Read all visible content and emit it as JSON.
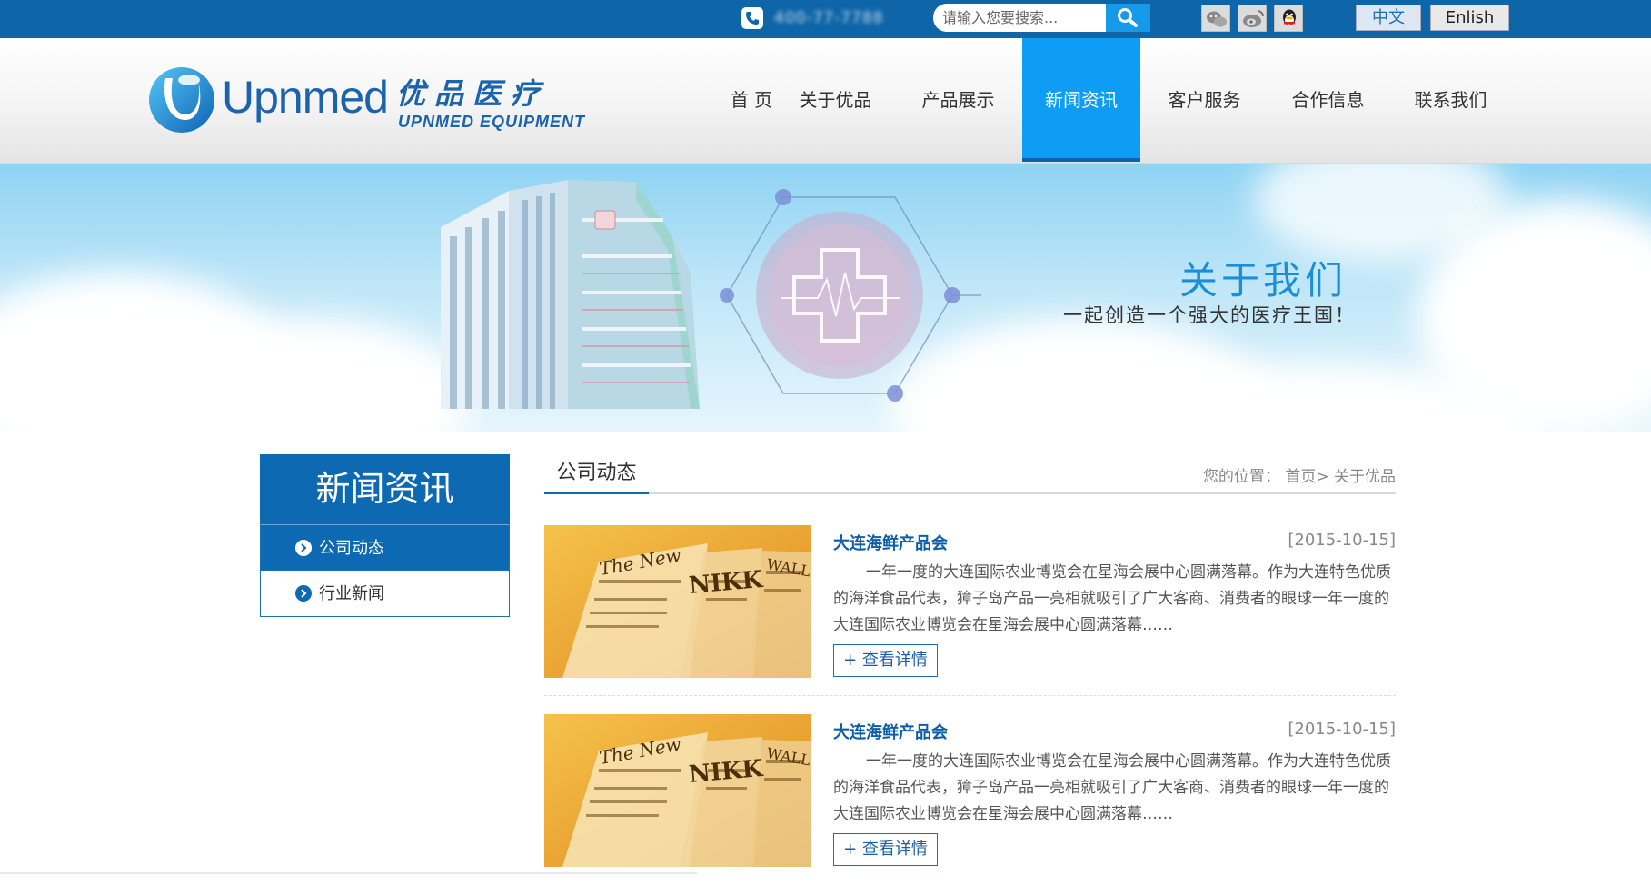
{
  "topbar": {
    "phone_number": "400-77-7788",
    "search": {
      "placeholder": "请输入您要搜索..."
    },
    "languages": {
      "chinese": "中文",
      "english": "Enlish"
    }
  },
  "logo": {
    "en": "Upnmed",
    "cn": "优品医疗",
    "sub": "UPNMED EQUIPMENT"
  },
  "nav": [
    "首 页",
    "关于优品",
    "产品展示",
    "新闻资讯",
    "客户服务",
    "合作信息",
    "联系我们"
  ],
  "nav_active": "新闻资讯",
  "banner": {
    "title": "关于我们",
    "subtitle": "一起创造一个强大的医疗王国！"
  },
  "sidebar": {
    "title": "新闻资讯",
    "items": [
      {
        "label": "公司动态",
        "active": true
      },
      {
        "label": "行业新闻",
        "active": false
      }
    ]
  },
  "section": {
    "tab": "公司动态",
    "breadcrumb": {
      "prefix": "您的位置：",
      "home": "首页",
      "separator": "> ",
      "current": "关于优品"
    }
  },
  "news": [
    {
      "title": "大连海鲜产品会",
      "date": "[2015-10-15]",
      "description": "一年一度的大连国际农业博览会在星海会展中心圆满落幕。作为大连特色优质的海洋食品代表，獐子岛产品一亮相就吸引了广大客商、消费者的眼球一年一度的大连国际农业博览会在星海会展中心圆满落幕……",
      "more": "+ 查看详情"
    },
    {
      "title": "大连海鲜产品会",
      "date": "[2015-10-15]",
      "description": "一年一度的大连国际农业博览会在星海会展中心圆满落幕。作为大连特色优质的海洋食品代表，獐子岛产品一亮相就吸引了广大客商、消费者的眼球一年一度的大连国际农业博览会在星海会展中心圆满落幕……",
      "more": "+ 查看详情"
    }
  ],
  "icons": [
    "phone-icon",
    "search-icon",
    "wechat-icon",
    "weibo-icon",
    "qq-icon",
    "logo-mark-icon",
    "chevron-right-icon"
  ],
  "colors": {
    "topbar": "#0e66a8",
    "nav_active": "#0e9cf5",
    "sidebar": "#0d6ab2",
    "title_blue": "#1a8fd8"
  }
}
